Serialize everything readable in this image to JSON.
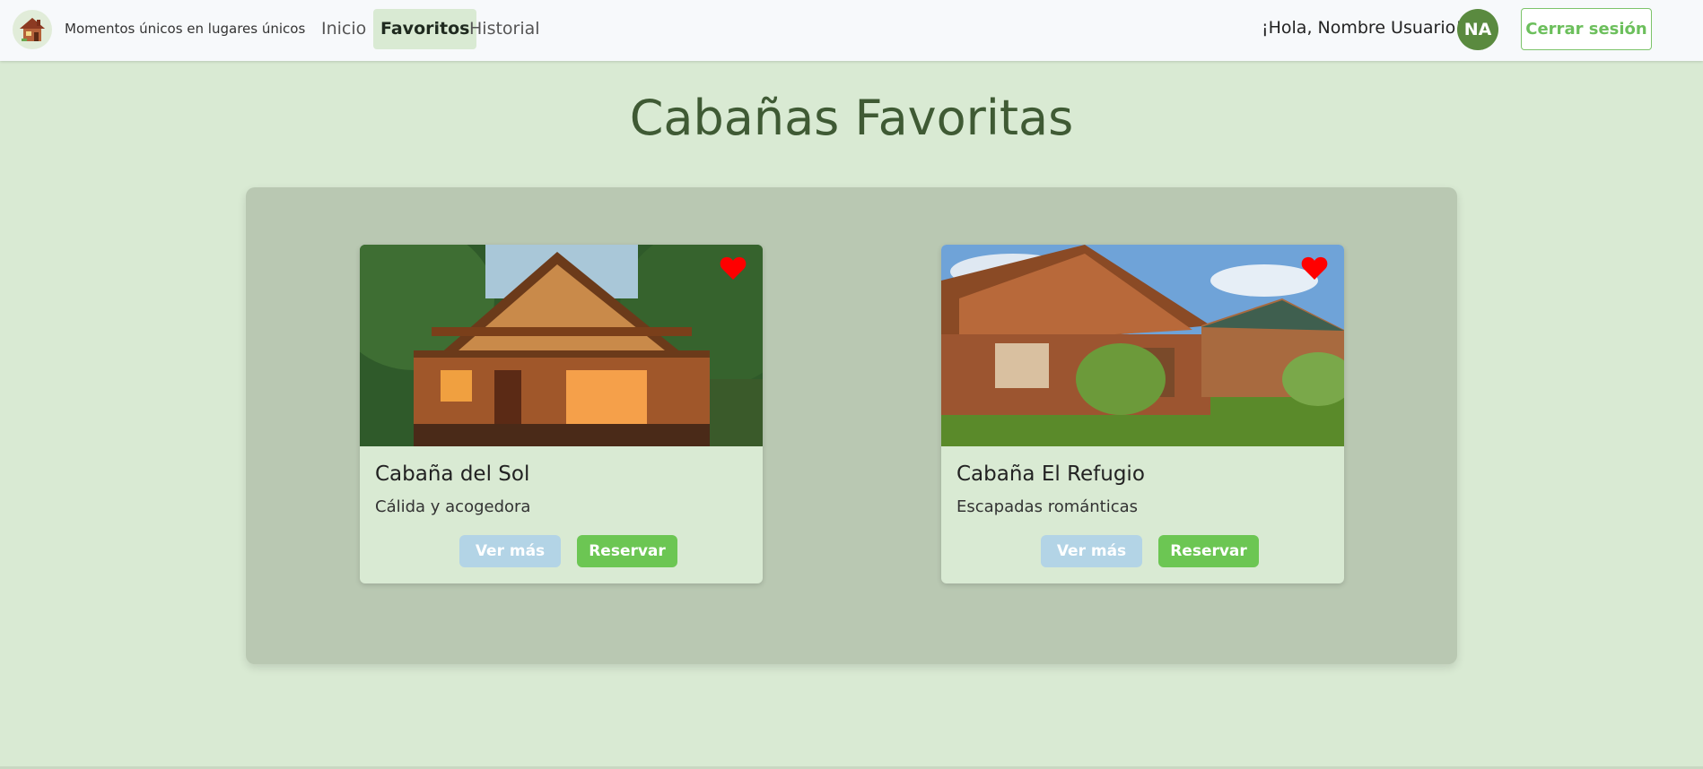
{
  "navbar": {
    "brand": "Momentos únicos en lugares únicos",
    "links": [
      {
        "label": "Inicio",
        "active": false
      },
      {
        "label": "Favoritos",
        "active": true
      },
      {
        "label": "Historial",
        "active": false
      }
    ],
    "greeting": "¡Hola, Nombre Usuario!",
    "avatar_initials": "NA",
    "logout_label": "Cerrar sesión"
  },
  "page": {
    "title": "Cabañas Favoritas"
  },
  "cards": [
    {
      "title": "Cabaña del Sol",
      "description": "Cálida y acogedora",
      "favorite": true,
      "more_label": "Ver más",
      "book_label": "Reservar",
      "image_icon": "wood-cabin-photo"
    },
    {
      "title": "Cabaña El Refugio",
      "description": "Escapadas románticas",
      "favorite": true,
      "more_label": "Ver más",
      "book_label": "Reservar",
      "image_icon": "log-cabins-photo"
    }
  ],
  "colors": {
    "background": "#d9ead3",
    "panel": "#b9c8b2",
    "title": "#3f5a34",
    "accent_green": "#6cc653",
    "accent_blue": "#b3d4e6",
    "heart": "#ff0000",
    "avatar": "#5a8a3f"
  }
}
